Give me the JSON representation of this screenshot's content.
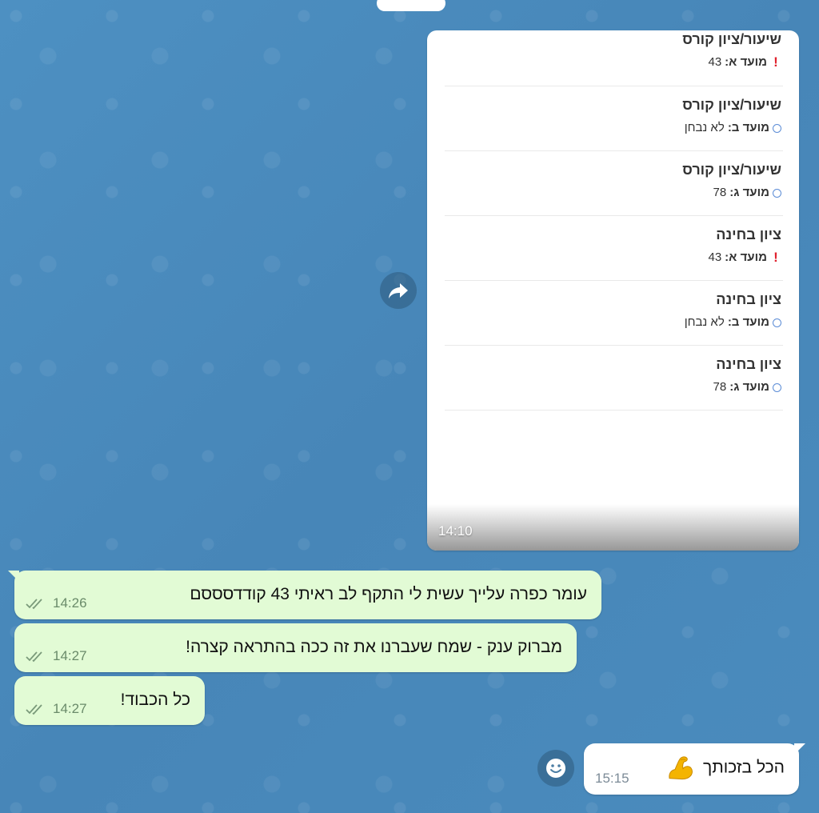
{
  "image_message": {
    "time": "14:10",
    "grades": [
      {
        "title": "שיעור/ציון קורס",
        "term": "מועד א:",
        "value": "43",
        "status": "failed"
      },
      {
        "title": "שיעור/ציון קורס",
        "term": "מועד ב:",
        "value": "לא נבחן",
        "status": "open"
      },
      {
        "title": "שיעור/ציון קורס",
        "term": "מועד ג:",
        "value": "78",
        "status": "open"
      },
      {
        "title": "ציון בחינה",
        "term": "מועד א:",
        "value": "43",
        "status": "failed"
      },
      {
        "title": "ציון בחינה",
        "term": "מועד ב:",
        "value": "לא נבחן",
        "status": "open"
      },
      {
        "title": "ציון בחינה",
        "term": "מועד ג:",
        "value": "78",
        "status": "open"
      }
    ]
  },
  "messages": [
    {
      "text": "עומר כפרה עלייך עשית לי התקף לב ראיתי 43 קודדסססם",
      "time": "14:26",
      "read": true
    },
    {
      "text": "מברוק ענק - שמח שעברנו את זה ככה בהתראה קצרה!",
      "time": "14:27",
      "read": true
    },
    {
      "text": "כל הכבוד!",
      "time": "14:27",
      "read": true
    }
  ],
  "outgoing": {
    "text": "הכל בזכותך",
    "emoji": "flexed-biceps",
    "time": "15:15"
  },
  "colors": {
    "chat_background": "#4a8bbd",
    "incoming_bubble": "#e2fbd5",
    "outgoing_bubble": "#ffffff",
    "failed_mark": "#e0212d",
    "open_mark": "#5b8cd6"
  }
}
